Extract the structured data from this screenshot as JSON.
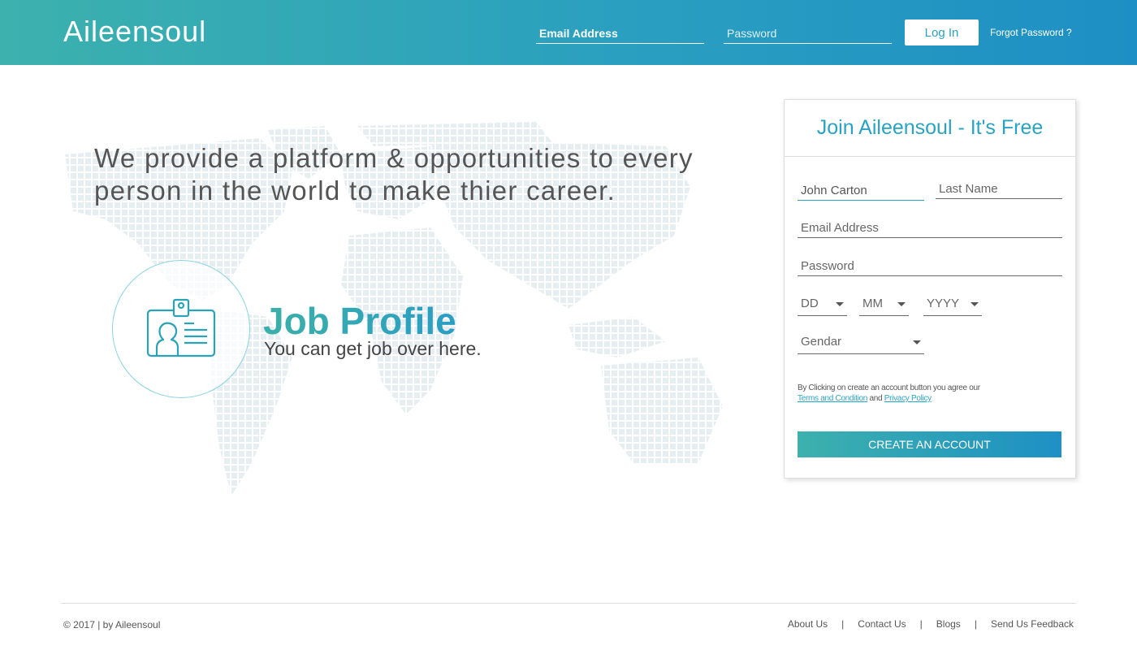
{
  "header": {
    "logo": "Aileensoul",
    "email_placeholder": "Email Address",
    "password_placeholder": "Password",
    "login_label": "Log In",
    "forgot_label": "Forgot Password ?"
  },
  "hero": {
    "tagline": "We provide a platform & opportunities to every person in the world to make thier career.",
    "feature_title": "Job Profile",
    "feature_subtitle": "You can get job over here."
  },
  "register": {
    "heading": "Join Aileensoul - It's Free",
    "first_name_value": "John Carton",
    "last_name_placeholder": "Last Name",
    "email_placeholder": "Email Address",
    "password_placeholder": "Password",
    "day_label": "DD",
    "month_label": "MM",
    "year_label": "YYYY",
    "gender_label": "Gendar",
    "terms_text": "By Clicking on create an account button you agree our",
    "terms_link": "Terms and Condition",
    "terms_and": "and",
    "privacy_link": "Privacy Policy",
    "create_label": "CREATE AN ACCOUNT"
  },
  "footer": {
    "copyright": "© 2017 | by Aileensoul",
    "links": [
      "About Us",
      "Contact Us",
      "Blogs",
      "Send Us Feedback"
    ],
    "separator": "|"
  },
  "colors": {
    "accent": "#2aa3c2",
    "gradient_start": "#3cb1ad",
    "gradient_end": "#1e8fc4"
  }
}
